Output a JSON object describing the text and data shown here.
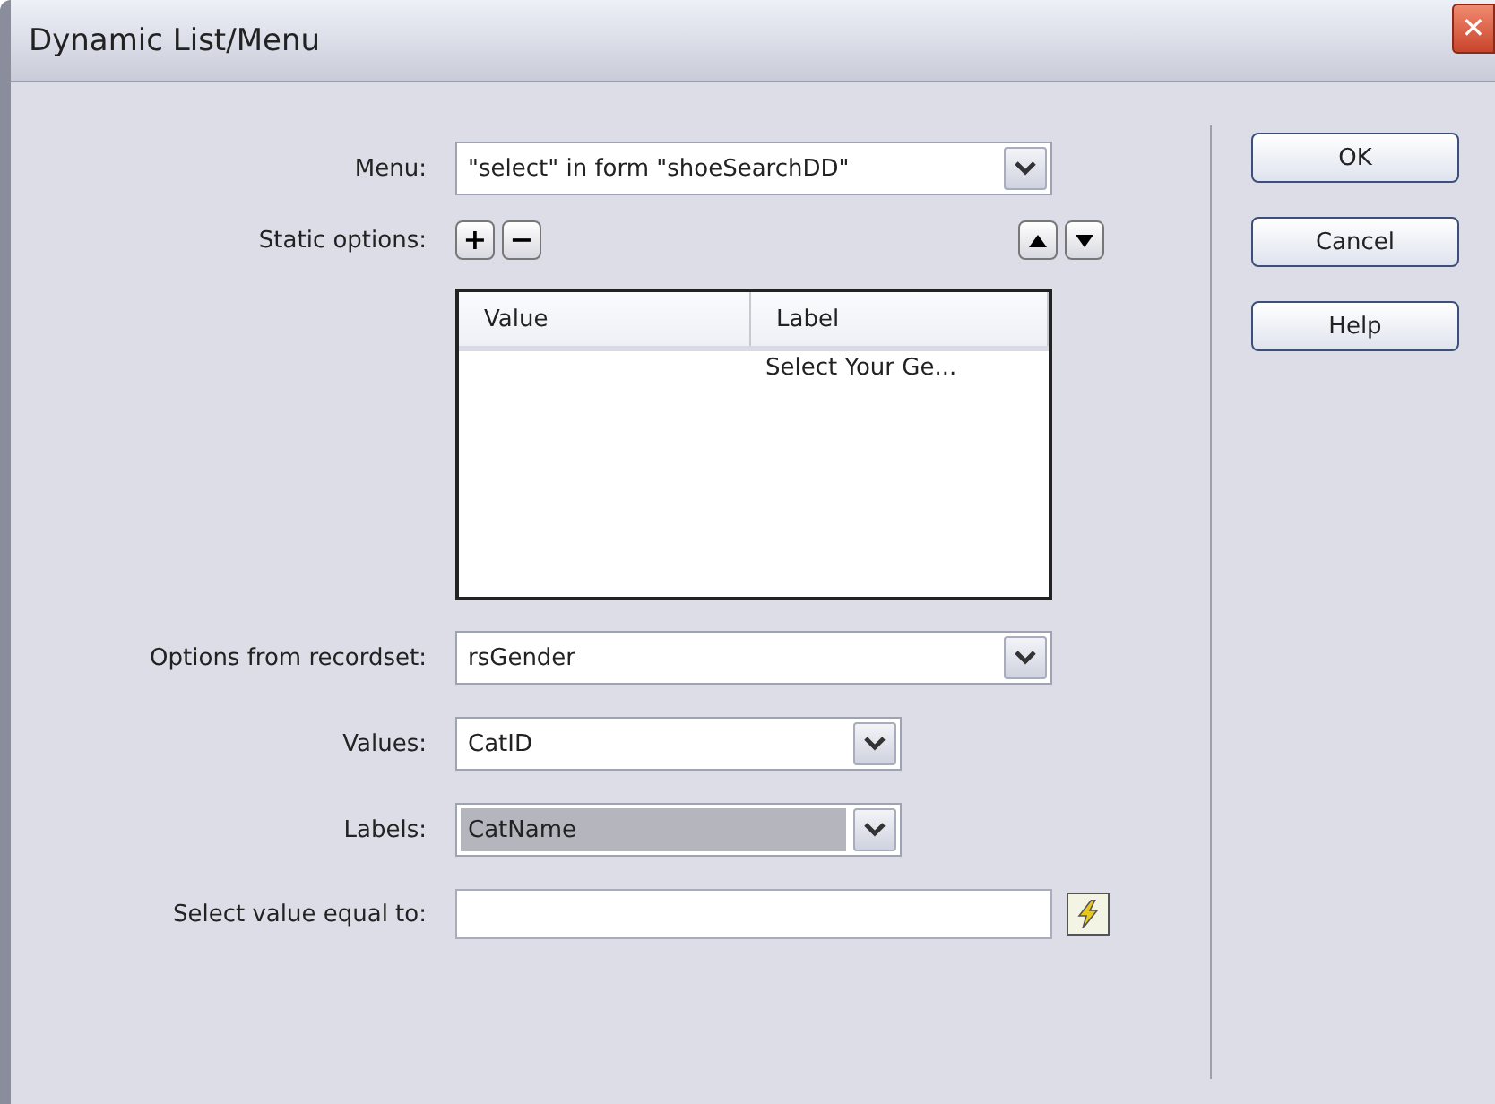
{
  "window": {
    "title": "Dynamic List/Menu",
    "close": "✕"
  },
  "form": {
    "menu": {
      "label": "Menu:",
      "value": "\"select\" in form \"shoeSearchDD\""
    },
    "static_options": {
      "label": "Static options:",
      "add": "+",
      "remove": "−"
    },
    "list": {
      "columns": [
        "Value",
        "Label"
      ],
      "rows": [
        {
          "label": "Select Your Ge..."
        }
      ]
    },
    "recordset": {
      "label": "Options from recordset:",
      "value": "rsGender"
    },
    "values": {
      "label": "Values:",
      "value": "CatID",
      "highlighted": false
    },
    "labels": {
      "label": "Labels:",
      "value": "CatName",
      "highlighted": true
    },
    "equal_to": {
      "label": "Select value equal to:"
    }
  },
  "buttons": [
    "OK",
    "Cancel",
    "Help"
  ]
}
